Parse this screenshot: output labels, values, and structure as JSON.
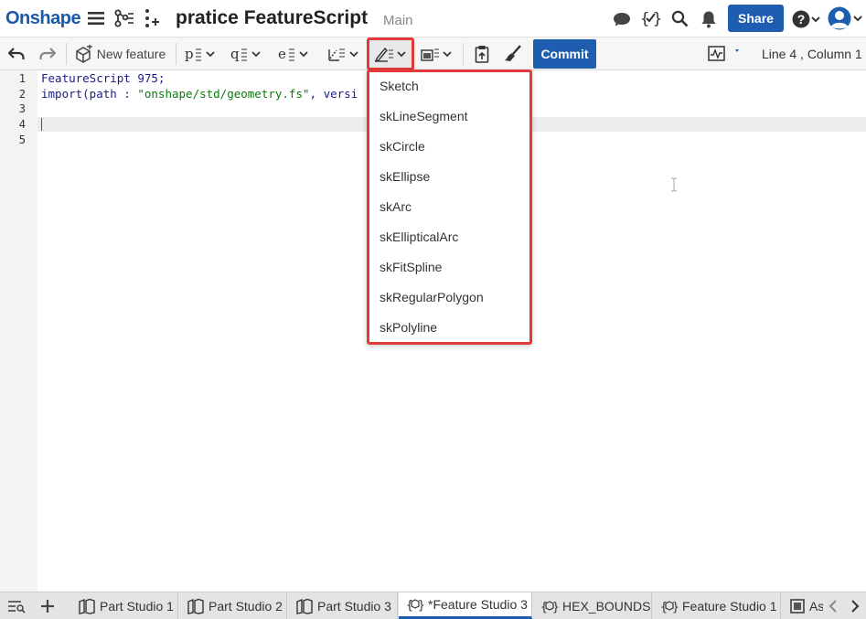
{
  "app": {
    "logo": "Onshape",
    "document_title": "pratice FeatureScript",
    "workspace": "Main",
    "share_label": "Share"
  },
  "icons": {
    "menu": "hamburger-icon",
    "versions": "version-graph-icon",
    "insert": "insert-icon",
    "comment": "comment-icon",
    "featurescript": "featurescript-icon",
    "search": "search-icon",
    "notifications": "bell-icon",
    "help": "help-icon",
    "user": "user-icon"
  },
  "toolbar": {
    "new_feature_label": "New feature",
    "commit_label": "Commit",
    "status": "Line 4 , Column 1"
  },
  "editor": {
    "line_numbers": [
      "1",
      "2",
      "3",
      "4",
      "5"
    ],
    "line1": "FeatureScript 975;",
    "line2_prefix": "import(path : ",
    "line2_string": "\"onshape/std/geometry.fs\"",
    "line2_suffix": ", versi"
  },
  "dropdown": {
    "items": [
      "Sketch",
      "skLineSegment",
      "skCircle",
      "skEllipse",
      "skArc",
      "skEllipticalArc",
      "skFitSpline",
      "skRegularPolygon",
      "skPolyline"
    ]
  },
  "tabs": [
    {
      "label": "Part Studio 1",
      "icon": "part-studio-icon"
    },
    {
      "label": "Part Studio 2",
      "icon": "part-studio-icon"
    },
    {
      "label": "Part Studio 3",
      "icon": "part-studio-icon"
    },
    {
      "label": "*Feature Studio 3",
      "icon": "feature-studio-icon",
      "active": true
    },
    {
      "label": "HEX_BOUNDS",
      "icon": "feature-studio-icon"
    },
    {
      "label": "Feature Studio 1",
      "icon": "feature-studio-icon"
    },
    {
      "label": "As",
      "icon": "assembly-icon"
    }
  ],
  "colors": {
    "brand": "#1e5db0",
    "highlight": "#e03a3a"
  }
}
